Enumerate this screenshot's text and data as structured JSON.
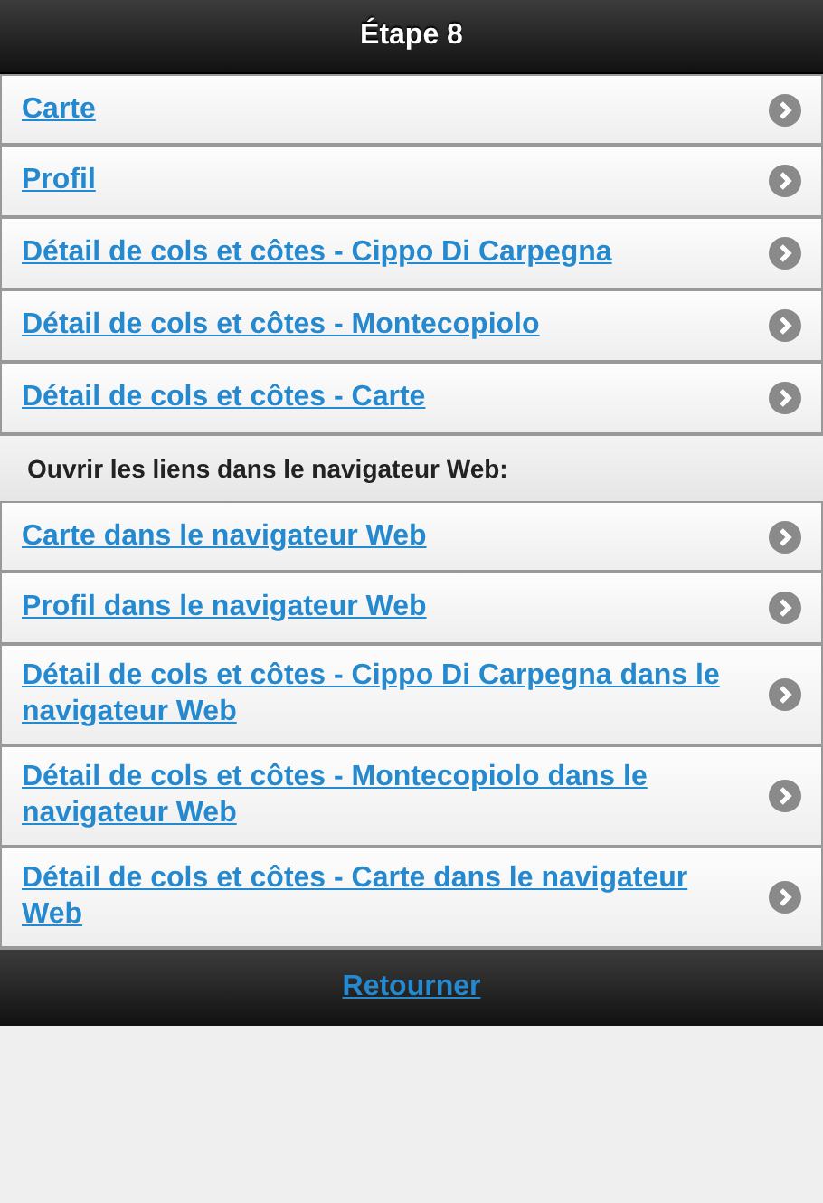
{
  "header": {
    "title": "Étape 8"
  },
  "links": [
    {
      "label": "Carte"
    },
    {
      "label": "Profil"
    },
    {
      "label": "Détail de cols et côtes - Cippo Di Carpegna"
    },
    {
      "label": "Détail de cols et côtes - Montecopiolo"
    },
    {
      "label": "Détail de cols et côtes - Carte"
    }
  ],
  "browser_section": {
    "heading": "Ouvrir les liens dans le navigateur Web:",
    "links": [
      {
        "label": "Carte dans le navigateur Web"
      },
      {
        "label": "Profil dans le navigateur Web"
      },
      {
        "label": "Détail de cols et côtes - Cippo Di Carpegna dans le navigateur Web"
      },
      {
        "label": "Détail de cols et côtes - Montecopiolo dans le navigateur Web"
      },
      {
        "label": "Détail de cols et côtes - Carte dans le navigateur Web"
      }
    ]
  },
  "footer": {
    "back": "Retourner"
  }
}
